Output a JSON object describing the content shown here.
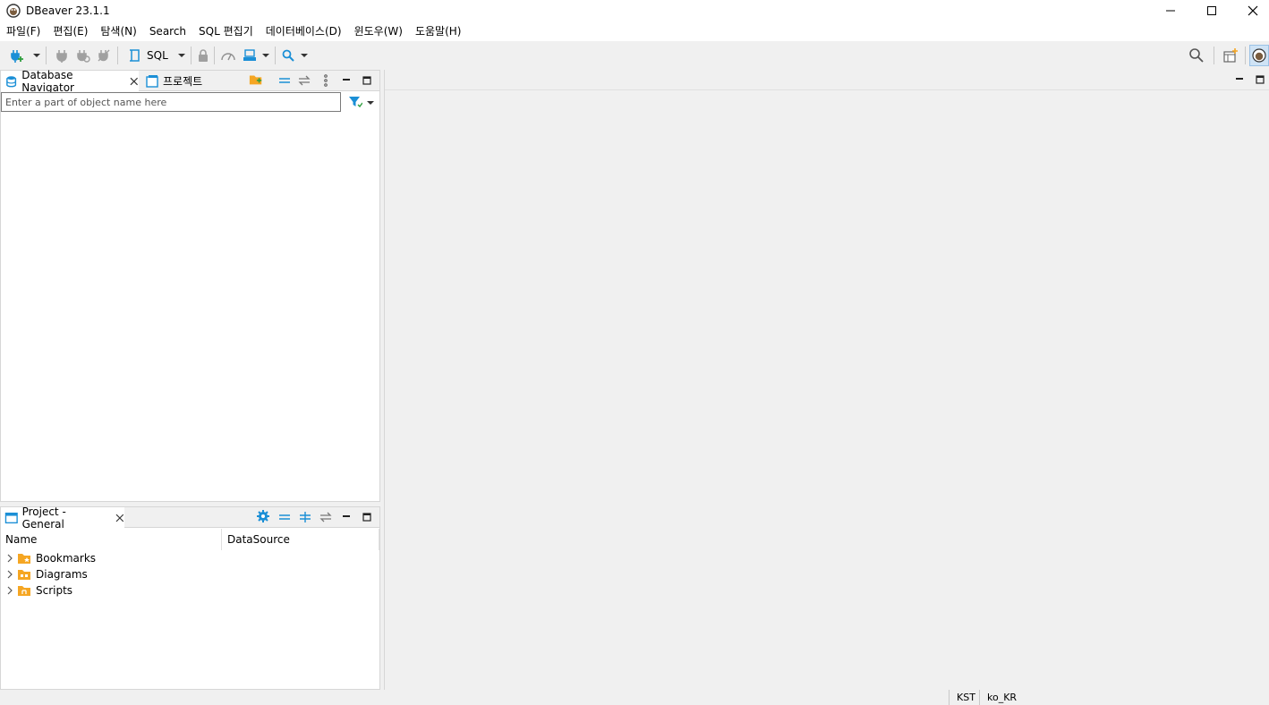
{
  "window": {
    "title": "DBeaver 23.1.1"
  },
  "menu": [
    "파일(F)",
    "편집(E)",
    "탐색(N)",
    "Search",
    "SQL 편집기",
    "데이터베이스(D)",
    "윈도우(W)",
    "도움말(H)"
  ],
  "toolbar": {
    "sql_label": "SQL"
  },
  "navigator": {
    "tab_label": "Database Navigator",
    "projects_tab_label": "프로젝트",
    "filter_placeholder": "Enter a part of object name here"
  },
  "project": {
    "tab_label": "Project - General",
    "columns": [
      "Name",
      "DataSource"
    ],
    "items": [
      "Bookmarks",
      "Diagrams",
      "Scripts"
    ]
  },
  "status": {
    "timezone": "KST",
    "locale": "ko_KR"
  },
  "colors": {
    "accent": "#1b8fd6",
    "folder": "#f5a623"
  }
}
